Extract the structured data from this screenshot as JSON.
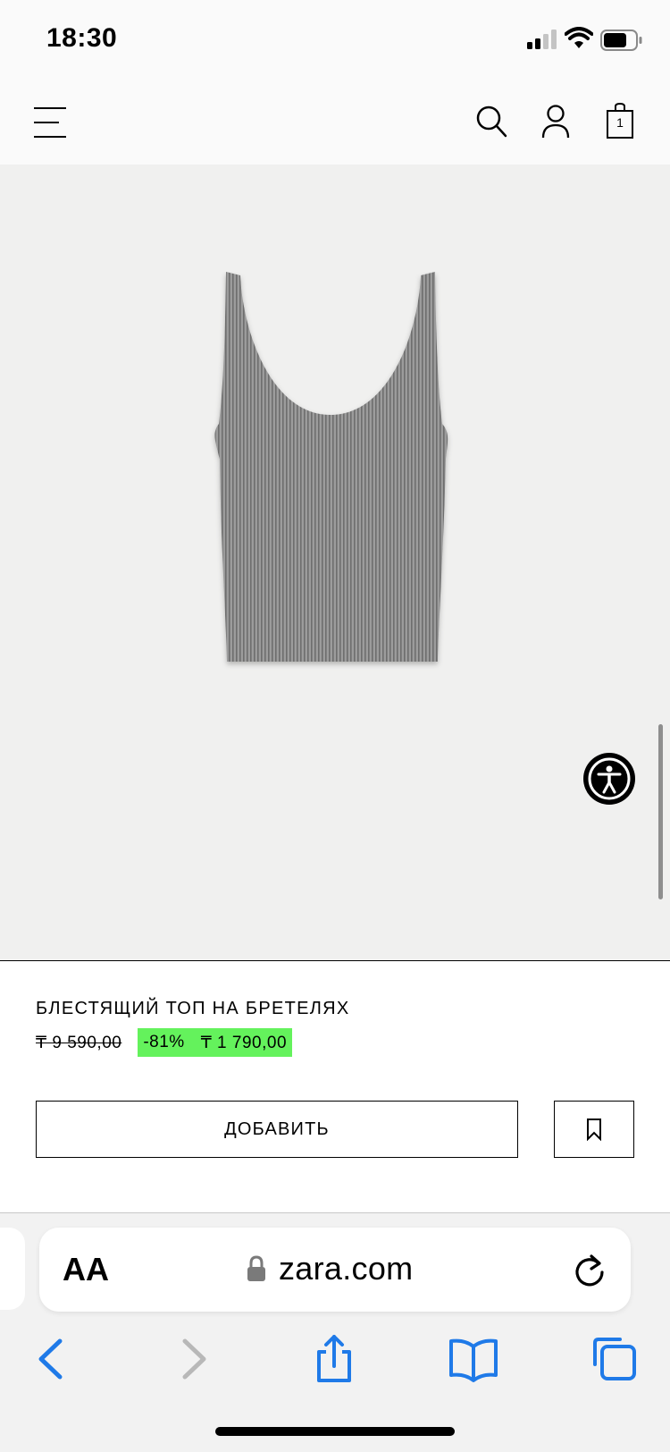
{
  "status_bar": {
    "time": "18:30"
  },
  "header": {
    "bag_count": "1"
  },
  "product": {
    "name": "БЛЕСТЯЩИЙ ТОП НА БРЕТЕЛЯХ",
    "old_price": "₸ 9 590,00",
    "discount": "-81%",
    "sale_price": "₸ 1 790,00",
    "image_icon": "tank-top-image"
  },
  "actions": {
    "add_label": "ДОБАВИТЬ"
  },
  "browser": {
    "text_size_label": "AA",
    "url": "zara.com"
  },
  "colors": {
    "sale_badge": "#64f25c",
    "product_bg": "#f0f0ef",
    "ios_blue": "#1f7ae8"
  }
}
